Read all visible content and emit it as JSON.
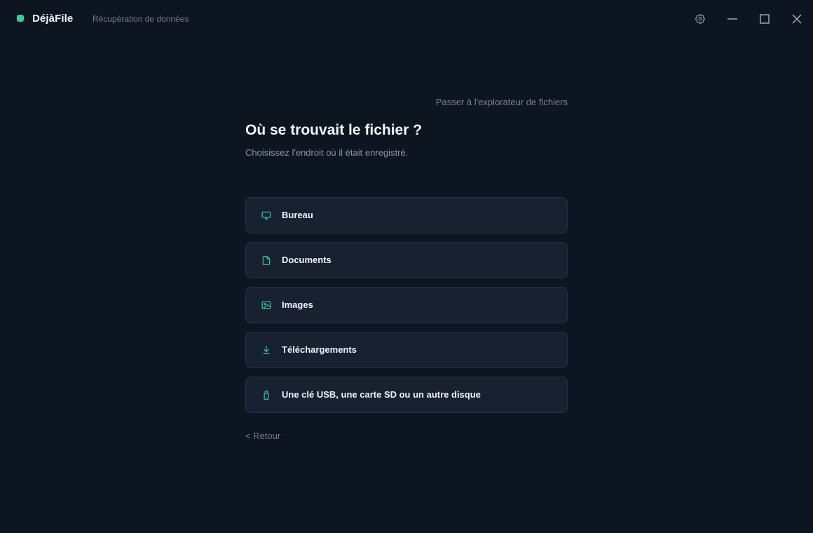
{
  "app": {
    "name": "DéjàFile",
    "subtitle": "Récupération de données",
    "accent_color": "#2fd3a1"
  },
  "window_controls": {
    "settings_icon": "gear-icon",
    "minimize_icon": "minimize-icon",
    "maximize_icon": "maximize-icon",
    "close_icon": "close-icon"
  },
  "main": {
    "skip_link": "Passer à l'explorateur de fichiers",
    "title": "Où se trouvait le fichier ?",
    "subtitle": "Choisissez l'endroit où il était enregistré.",
    "options": [
      {
        "label": "Bureau",
        "icon": "monitor-icon"
      },
      {
        "label": "Documents",
        "icon": "document-icon"
      },
      {
        "label": "Images",
        "icon": "image-icon"
      },
      {
        "label": "Téléchargements",
        "icon": "download-icon"
      },
      {
        "label": "Une clé USB, une carte SD ou un autre disque",
        "icon": "usb-drive-icon"
      }
    ],
    "back_link": "< Retour"
  }
}
